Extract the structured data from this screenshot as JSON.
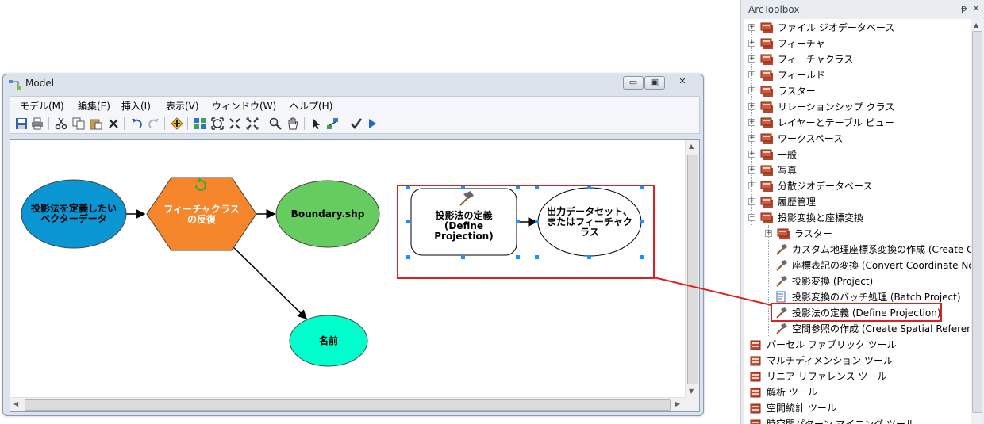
{
  "model_window": {
    "title": "Model",
    "controls": {
      "minimize": "▭",
      "maximize": "▣",
      "close": "✕"
    },
    "menu": [
      "モデル(M)",
      "編集(E)",
      "挿入(I)",
      "表示(V)",
      "ウィンドウ(W)",
      "ヘルプ(H)"
    ],
    "toolbar_icons": [
      "save-icon",
      "print-icon",
      "cut-icon",
      "copy-icon",
      "paste-icon",
      "delete-icon",
      "undo-icon",
      "redo-icon",
      "add-data-icon",
      "auto-layout-icon",
      "full-extent-icon",
      "zoom-in-fixed-icon",
      "zoom-out-fixed-icon",
      "zoom-icon",
      "pan-icon",
      "select-icon",
      "connect-icon",
      "validate-icon",
      "run-icon"
    ],
    "nodes": {
      "input_data": "投影法を定義したいベクターデータ",
      "iterator": "フィーチャクラスの反復",
      "boundary": "Boundary.shp",
      "name": "名前",
      "define_tool": "投影法の定義(Define Projection)",
      "output": "出力データセット、またはフィーチャクラス"
    },
    "colors": {
      "input_fill": "#0a95d3",
      "iterator_fill": "#f5862b",
      "boundary_fill": "#66cc60",
      "name_fill": "#00ffcc",
      "highlight": "#e02020"
    }
  },
  "arctoolbox": {
    "title": "ArcToolbox",
    "pin": "ᵽ",
    "close": "×",
    "items": [
      {
        "label": "ファイル ジオデータベース",
        "type": "toolbox"
      },
      {
        "label": "フィーチャ",
        "type": "toolbox"
      },
      {
        "label": "フィーチャクラス",
        "type": "toolbox"
      },
      {
        "label": "フィールド",
        "type": "toolbox"
      },
      {
        "label": "ラスター",
        "type": "toolbox"
      },
      {
        "label": "リレーションシップ クラス",
        "type": "toolbox"
      },
      {
        "label": "レイヤーとテーブル ビュー",
        "type": "toolbox"
      },
      {
        "label": "ワークスペース",
        "type": "toolbox"
      },
      {
        "label": "一般",
        "type": "toolbox"
      },
      {
        "label": "写真",
        "type": "toolbox"
      },
      {
        "label": "分散ジオデータベース",
        "type": "toolbox"
      },
      {
        "label": "履歴管理",
        "type": "toolbox"
      },
      {
        "label": "投影変換と座標変換",
        "type": "toolbox-open"
      },
      {
        "label": "ラスター",
        "type": "toolbox-sub"
      },
      {
        "label": "カスタム地理座標系変換の作成 (Create Custom Geographic Transformation)",
        "type": "tool"
      },
      {
        "label": "座標表記の変換 (Convert Coordinate Notation)",
        "type": "tool"
      },
      {
        "label": "投影変換 (Project)",
        "type": "tool"
      },
      {
        "label": "投影変換のバッチ処理 (Batch Project)",
        "type": "script"
      },
      {
        "label": "投影法の定義 (Define Projection)",
        "type": "tool-selected"
      },
      {
        "label": "空間参照の作成 (Create Spatial Reference)",
        "type": "tool"
      },
      {
        "label": "パーセル ファブリック ツール",
        "type": "toolset"
      },
      {
        "label": "マルチディメンション ツール",
        "type": "toolset"
      },
      {
        "label": "リニア リファレンス ツール",
        "type": "toolset"
      },
      {
        "label": "解析 ツール",
        "type": "toolset"
      },
      {
        "label": "空間統計 ツール",
        "type": "toolset"
      },
      {
        "label": "時空間パターン マイニング ツール",
        "type": "toolset"
      }
    ]
  }
}
